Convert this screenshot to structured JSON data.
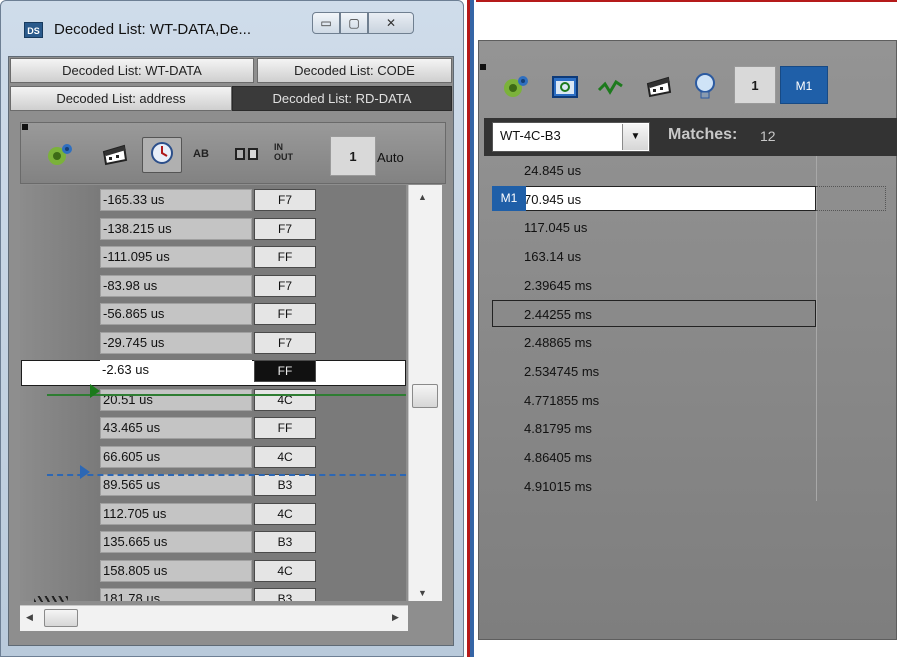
{
  "window": {
    "app_icon": "DS",
    "title": "Decoded List: WT-DATA,De...",
    "minimize_glyph": "▭",
    "maximize_glyph": "▢",
    "close_glyph": "✕"
  },
  "tabs": [
    {
      "label": "Decoded List: WT-DATA",
      "active": false
    },
    {
      "label": "Decoded List: CODE",
      "active": false
    },
    {
      "label": "Decoded List: address",
      "active": false
    },
    {
      "label": "Decoded List: RD-DATA",
      "active": true
    }
  ],
  "left_toolbar": {
    "icons": [
      "gear-icon",
      "cheese-icon",
      "timing-icon",
      "abcd-icon",
      "compare-icon",
      "in-out-icon"
    ],
    "count": "1",
    "auto_label": "Auto",
    "ab_text": "AB",
    "in_out_text": "IN OUT"
  },
  "left_list": {
    "rows": [
      {
        "time": "-165.33 us",
        "value": "F7"
      },
      {
        "time": "-138.215 us",
        "value": "F7"
      },
      {
        "time": "-111.095 us",
        "value": "FF"
      },
      {
        "time": "-83.98 us",
        "value": "F7"
      },
      {
        "time": "-56.865 us",
        "value": "FF"
      },
      {
        "time": "-29.745 us",
        "value": "F7"
      },
      {
        "time": "-2.63 us",
        "value": "FF",
        "selected": true
      },
      {
        "time": "20.51 us",
        "value": "4C"
      },
      {
        "time": "43.465 us",
        "value": "FF"
      },
      {
        "time": "66.605 us",
        "value": "4C"
      },
      {
        "time": "89.565 us",
        "value": "B3"
      },
      {
        "time": "112.705 us",
        "value": "4C"
      },
      {
        "time": "135.665 us",
        "value": "B3"
      },
      {
        "time": "158.805 us",
        "value": "4C"
      },
      {
        "time": "181.78 us",
        "value": "B3"
      }
    ]
  },
  "scrollbars": {
    "up": "▲",
    "down": "▼",
    "left": "◀",
    "right": "▶"
  },
  "right_toolbar": {
    "icons": [
      "gear-icon",
      "oscilloscope-icon",
      "waveform-icon",
      "cheese-icon",
      "lightbulb-icon"
    ],
    "count": "1",
    "marker_label": "M1"
  },
  "search": {
    "selected": "WT-4C-B3",
    "dropdown_glyph": "▼",
    "matches_label": "Matches:",
    "matches_count": "12"
  },
  "matches": [
    {
      "time": "24.845 us"
    },
    {
      "time": "70.945 us",
      "marker": "M1"
    },
    {
      "time": "117.045 us"
    },
    {
      "time": "163.14 us"
    },
    {
      "time": "2.39645 ms"
    },
    {
      "time": "2.44255 ms",
      "boxed": true
    },
    {
      "time": "2.48865 ms"
    },
    {
      "time": "2.534745 ms"
    },
    {
      "time": "4.771855 ms"
    },
    {
      "time": "4.81795 ms"
    },
    {
      "time": "4.86405 ms"
    },
    {
      "time": "4.91015 ms"
    }
  ]
}
